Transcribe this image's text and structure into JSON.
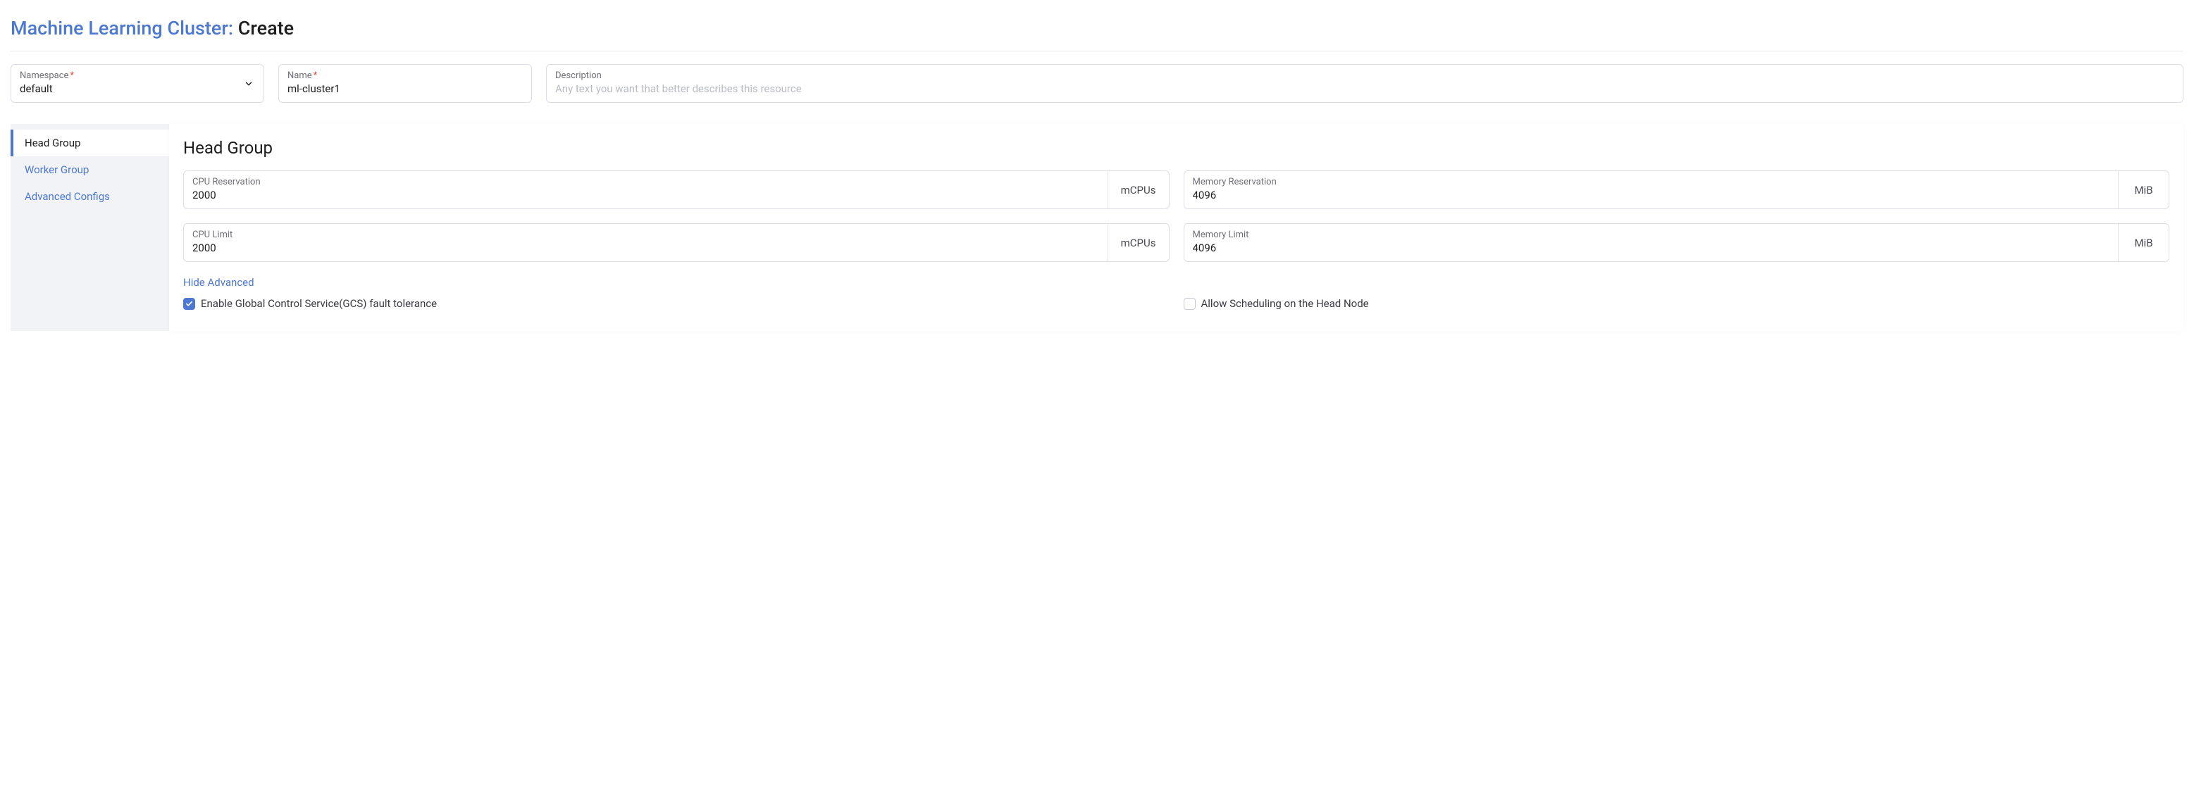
{
  "title": {
    "prefix": "Machine Learning Cluster:",
    "action": "Create"
  },
  "top": {
    "namespace": {
      "label": "Namespace",
      "value": "default"
    },
    "name": {
      "label": "Name",
      "value": "ml-cluster1"
    },
    "desc": {
      "label": "Description",
      "placeholder": "Any text you want that better describes this resource"
    }
  },
  "tabs": {
    "head": "Head Group",
    "worker": "Worker Group",
    "advanced": "Advanced Configs"
  },
  "panel": {
    "heading": "Head Group",
    "cpu_res": {
      "label": "CPU Reservation",
      "value": "2000",
      "unit": "mCPUs"
    },
    "mem_res": {
      "label": "Memory Reservation",
      "value": "4096",
      "unit": "MiB"
    },
    "cpu_limit": {
      "label": "CPU Limit",
      "value": "2000",
      "unit": "mCPUs"
    },
    "mem_limit": {
      "label": "Memory Limit",
      "value": "4096",
      "unit": "MiB"
    },
    "hide_advanced": "Hide Advanced",
    "gcs_label": "Enable Global Control Service(GCS) fault tolerance",
    "sched_label": "Allow Scheduling on the Head Node"
  }
}
